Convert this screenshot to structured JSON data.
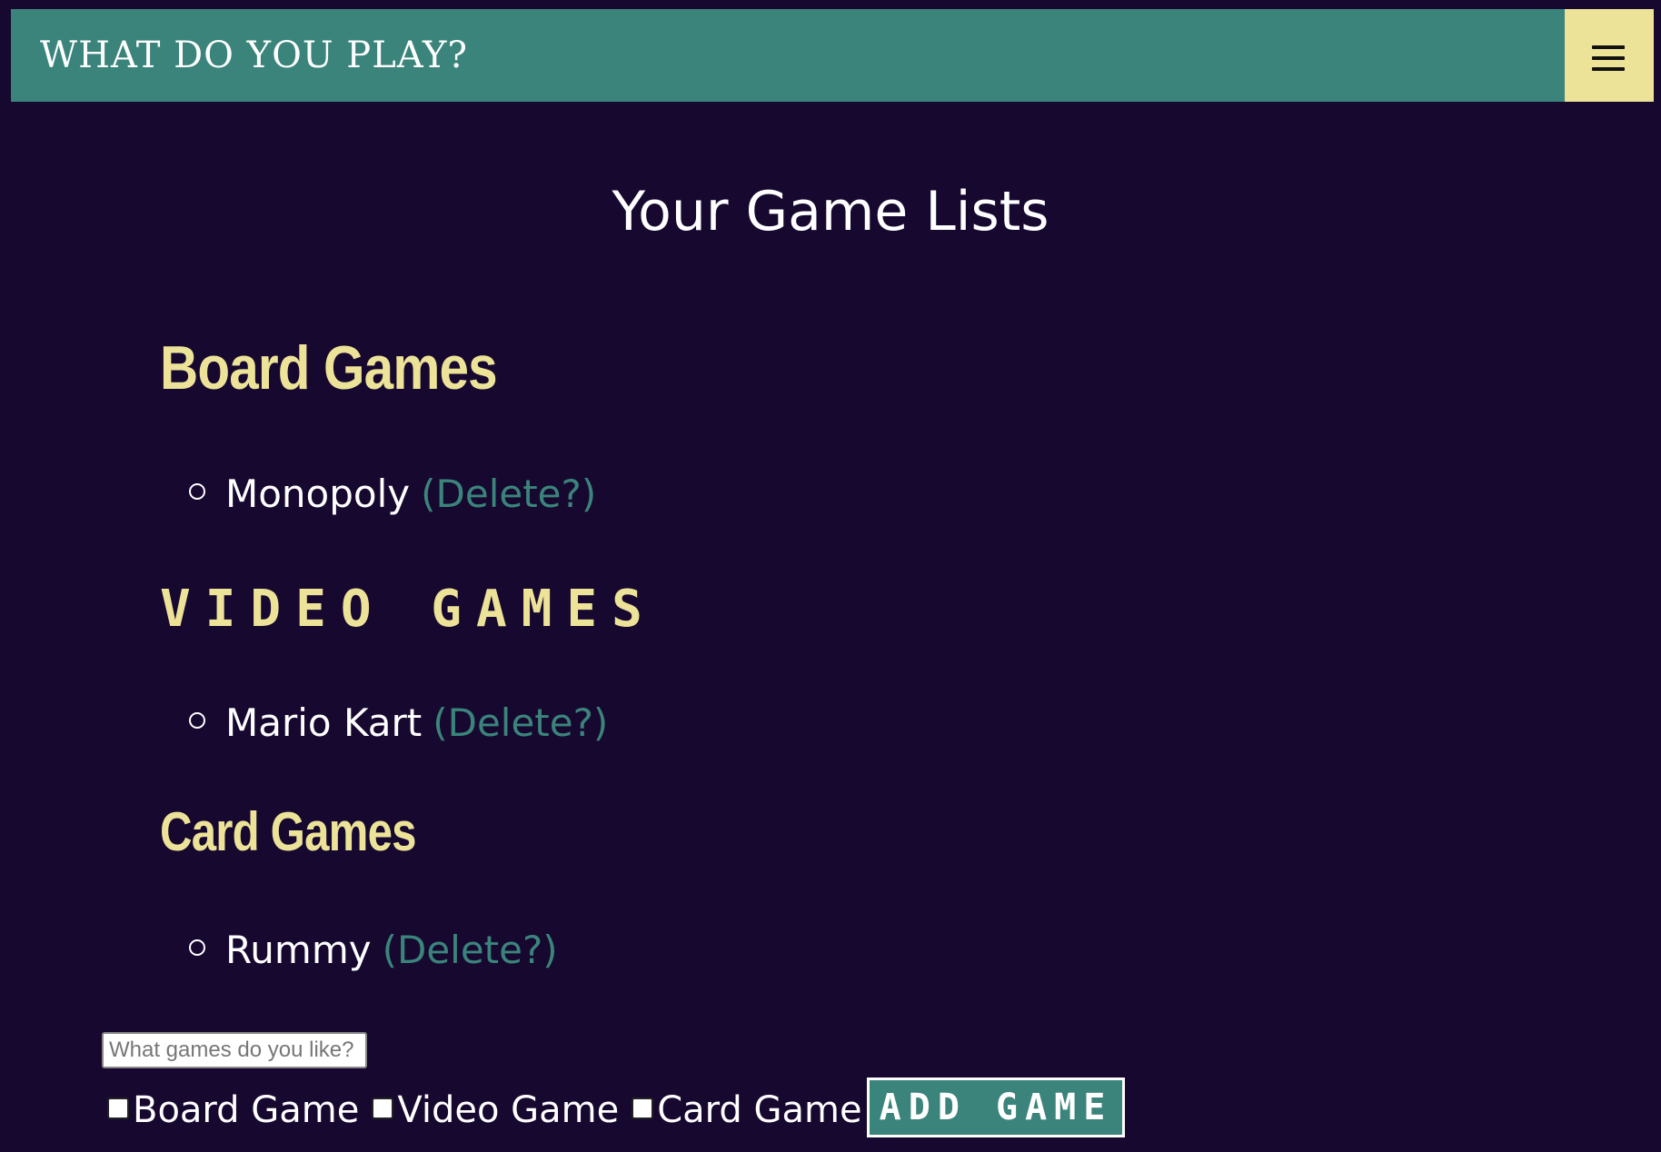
{
  "header": {
    "brand": "WHAT DO YOU PLAY?",
    "menu_icon": "hamburger-menu-icon"
  },
  "main": {
    "title": "Your Game Lists",
    "categories": [
      {
        "heading": "Board Games",
        "items": [
          {
            "name": "Monopoly",
            "delete_label": "(Delete?)"
          }
        ]
      },
      {
        "heading": "Video Games",
        "items": [
          {
            "name": "Mario Kart",
            "delete_label": "(Delete?)"
          }
        ]
      },
      {
        "heading": "Card Games",
        "items": [
          {
            "name": "Rummy",
            "delete_label": "(Delete?)"
          }
        ]
      }
    ]
  },
  "form": {
    "input_placeholder": "What games do you like?",
    "input_value": "",
    "checkboxes": [
      {
        "label": "Board Game",
        "checked": false
      },
      {
        "label": "Video Game",
        "checked": false
      },
      {
        "label": "Card Game",
        "checked": false
      }
    ],
    "submit_label": "Add Game"
  },
  "colors": {
    "background": "#170830",
    "accent_teal": "#3b847b",
    "accent_yellow": "#ece398",
    "text": "#ffffff"
  }
}
